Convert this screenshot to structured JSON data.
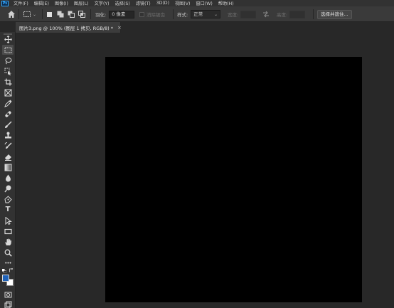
{
  "app": {
    "logo": "Ps"
  },
  "menu": [
    "文件(F)",
    "编辑(E)",
    "图像(I)",
    "图层(L)",
    "文字(Y)",
    "选择(S)",
    "滤镜(T)",
    "3D(D)",
    "视图(V)",
    "窗口(W)",
    "帮助(H)"
  ],
  "options": {
    "feather_label": "羽化:",
    "feather_value": "0 像素",
    "antialias_label": "消除锯齿",
    "style_label": "样式:",
    "style_value": "正常",
    "width_label": "宽度:",
    "height_label": "高度:",
    "select_subject_button": "选择并遮住..."
  },
  "document": {
    "tab_title": "图片3.png @ 100% (图层 1 拷贝, RGB/8) *",
    "close": "×",
    "canvas_color": "#000000"
  },
  "toolbar": {
    "type_tool_glyph": "T",
    "more_glyph": "•••",
    "foreground_color": "#1f62b8",
    "background_color": "#ffffff"
  }
}
